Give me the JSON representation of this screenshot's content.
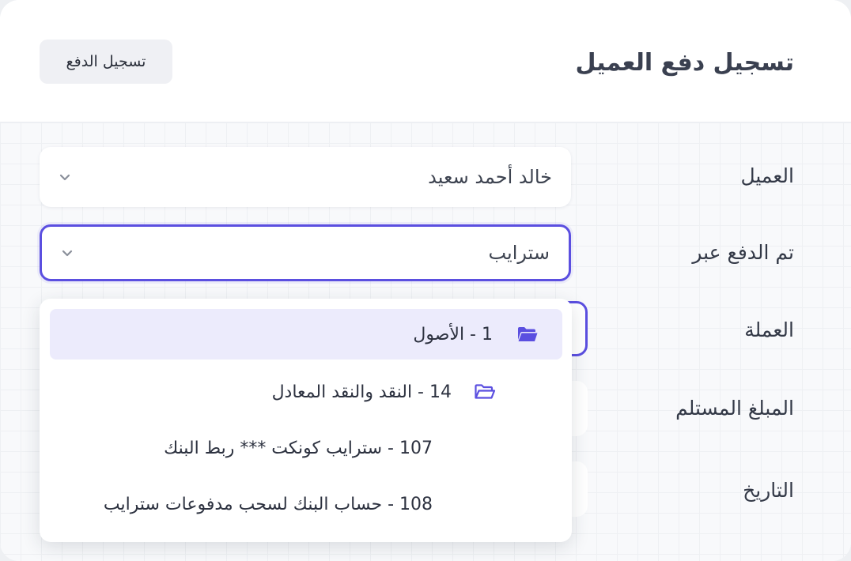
{
  "header": {
    "title": "تسجيل دفع العميل",
    "action_button": "تسجيل الدفع"
  },
  "form": {
    "customer": {
      "label": "العميل",
      "value": "خالد أحمد سعيد"
    },
    "paid_via": {
      "label": "تم الدفع عبر",
      "value": "سترايب"
    },
    "currency": {
      "label": "العملة"
    },
    "amount_received": {
      "label": "المبلغ المستلم"
    },
    "date": {
      "label": "التاريخ"
    }
  },
  "dropdown": {
    "options": [
      {
        "label": "1 - الأصول",
        "icon": "folder-open-icon",
        "selected": true
      },
      {
        "label": "14 - النقد والنقد المعادل",
        "icon": "folder-open-icon",
        "selected": false
      },
      {
        "label": "107 - سترايب كونكت *** ربط البنك",
        "selected": false
      },
      {
        "label": "108 - حساب البنك لسحب مدفوعات سترايب",
        "selected": false
      }
    ]
  },
  "colors": {
    "accent": "#5b4fe0",
    "selected_bg": "#ecebfc",
    "page_bg": "#f8f9fb"
  }
}
